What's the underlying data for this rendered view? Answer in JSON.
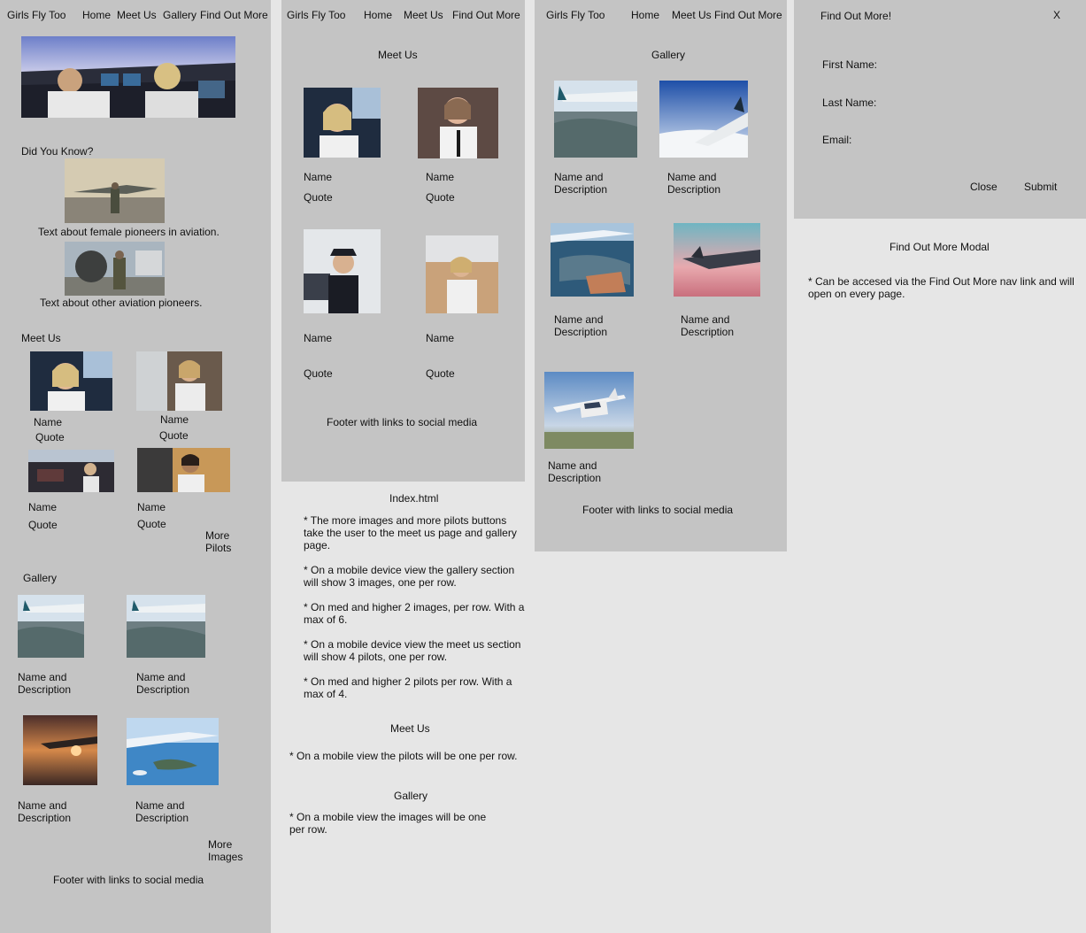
{
  "nav": {
    "brand": "Girls Fly Too",
    "home": "Home",
    "meet_us": "Meet Us",
    "gallery": "Gallery",
    "find_out_more": "Find Out More",
    "meet_us_find_out_more": "Meet Us Find Out More"
  },
  "index_page": {
    "did_you_know": "Did You Know?",
    "female_pioneers_text": "Text about female pioneers in aviation.",
    "other_pioneers_text": "Text about other aviation pioneers.",
    "meet_us_heading": "Meet Us",
    "pilots": [
      {
        "name": "Name",
        "quote": "Quote"
      },
      {
        "name": "Name",
        "quote": "Quote"
      },
      {
        "name": "Name",
        "quote": "Quote"
      },
      {
        "name": "Name",
        "quote": "Quote"
      }
    ],
    "more_pilots_line1": "More",
    "more_pilots_line2": "Pilots",
    "gallery_heading": "Gallery",
    "gallery_items": [
      {
        "line1": "Name and",
        "line2": "Description"
      },
      {
        "line1": "Name and",
        "line2": "Description"
      },
      {
        "line1": "Name and",
        "line2": "Description"
      },
      {
        "line1": "Name and",
        "line2": "Description"
      }
    ],
    "more_images_line1": "More",
    "more_images_line2": "Images",
    "footer": "Footer with links to social media"
  },
  "meet_us_page": {
    "heading": "Meet Us",
    "pilots": [
      {
        "name": "Name",
        "quote": "Quote"
      },
      {
        "name": "Name",
        "quote": "Quote"
      },
      {
        "name": "Name",
        "quote": "Quote"
      },
      {
        "name": "Name",
        "quote": "Quote"
      }
    ],
    "footer": "Footer with links to social media"
  },
  "notes": {
    "index_title": "Index.html",
    "index_notes": [
      "* The more images and more pilots buttons take the user to the meet us page and gallery page.",
      "* On a mobile device view the gallery section will show 3 images, one per row.",
      "* On med and higher 2 images, per row. With a max of  6.",
      "* On a mobile device view the meet us section will show 4 pilots, one per row.",
      "* On med and higher 2 pilots per row. With a max of 4."
    ],
    "meet_us_title": "Meet Us",
    "meet_us_note": "* On a mobile view the pilots will be one per row.",
    "gallery_title": "Gallery",
    "gallery_note": "* On a mobile view the images will be one per row."
  },
  "gallery_page": {
    "heading": "Gallery",
    "items": [
      {
        "line1": "Name and",
        "line2": "Description"
      },
      {
        "line1": "Name and",
        "line2": "Description"
      },
      {
        "line1": "Name and",
        "line2": "Description"
      },
      {
        "line1": "Name and",
        "line2": "Description"
      },
      {
        "line1": "Name and",
        "line2": "Description"
      }
    ],
    "footer": "Footer with links to social media"
  },
  "modal": {
    "title": "Find Out More!",
    "close_x": "X",
    "first_name": "First Name:",
    "last_name": "Last Name:",
    "email": "Email:",
    "close_button": "Close",
    "submit_button": "Submit"
  },
  "modal_notes": {
    "title": "Find Out More Modal",
    "note": "* Can be accesed via the Find Out More nav link and will open on every page."
  },
  "colors": {
    "panel": "#c4c4c4",
    "background": "#e6e6e6",
    "text": "#111111"
  }
}
